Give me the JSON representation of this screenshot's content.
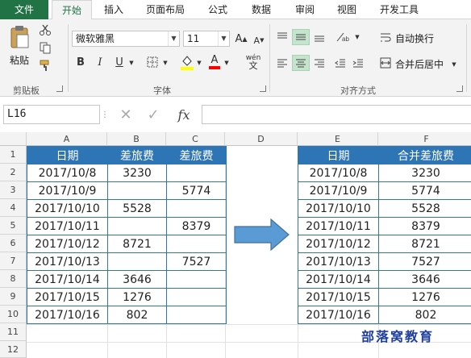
{
  "ribbon_tabs": [
    "文件",
    "开始",
    "插入",
    "页面布局",
    "公式",
    "数据",
    "审阅",
    "视图",
    "开发工具"
  ],
  "ribbon": {
    "paste_label": "粘贴",
    "clipboard_group": "剪贴板",
    "font_name": "微软雅黑",
    "font_size": "11",
    "font_group": "字体",
    "bold": "B",
    "italic": "I",
    "underline": "U",
    "wrap_text": "自动换行",
    "merge_center": "合并后居中",
    "alignment_group": "对齐方式",
    "phonetic": "wén"
  },
  "formula_bar": {
    "name_box": "L16",
    "fx": "fx",
    "formula": ""
  },
  "columns": [
    "A",
    "B",
    "C",
    "D",
    "E",
    "F"
  ],
  "rows": [
    "1",
    "2",
    "3",
    "4",
    "5",
    "6",
    "7",
    "8",
    "9",
    "10",
    "11",
    "12"
  ],
  "source_table": {
    "headers": [
      "日期",
      "差旅费",
      "差旅费"
    ],
    "rows": [
      [
        "2017/10/8",
        "3230",
        ""
      ],
      [
        "2017/10/9",
        "",
        "5774"
      ],
      [
        "2017/10/10",
        "5528",
        ""
      ],
      [
        "2017/10/11",
        "",
        "8379"
      ],
      [
        "2017/10/12",
        "8721",
        ""
      ],
      [
        "2017/10/13",
        "",
        "7527"
      ],
      [
        "2017/10/14",
        "3646",
        ""
      ],
      [
        "2017/10/15",
        "1276",
        ""
      ],
      [
        "2017/10/16",
        "802",
        ""
      ]
    ]
  },
  "result_table": {
    "headers": [
      "日期",
      "合并差旅费"
    ],
    "rows": [
      [
        "2017/10/8",
        "3230"
      ],
      [
        "2017/10/9",
        "5774"
      ],
      [
        "2017/10/10",
        "5528"
      ],
      [
        "2017/10/11",
        "8379"
      ],
      [
        "2017/10/12",
        "8721"
      ],
      [
        "2017/10/13",
        "7527"
      ],
      [
        "2017/10/14",
        "3646"
      ],
      [
        "2017/10/15",
        "1276"
      ],
      [
        "2017/10/16",
        "802"
      ]
    ]
  },
  "watermark": "部落窝教育",
  "colors": {
    "excel_green": "#217346",
    "table_blue": "#2e75b6",
    "arrow_blue": "#5b9bd5",
    "brand_blue": "#1f3f9e"
  },
  "icons": [
    "paste-icon",
    "cut-icon",
    "copy-icon",
    "format-painter-icon",
    "grow-font-icon",
    "shrink-font-icon",
    "border-icon",
    "fill-color-icon",
    "font-color-icon",
    "align-icon",
    "orientation-icon",
    "indent-icon",
    "wrap-icon",
    "merge-icon",
    "cancel-icon",
    "enter-icon",
    "function-icon",
    "right-arrow-shape"
  ]
}
